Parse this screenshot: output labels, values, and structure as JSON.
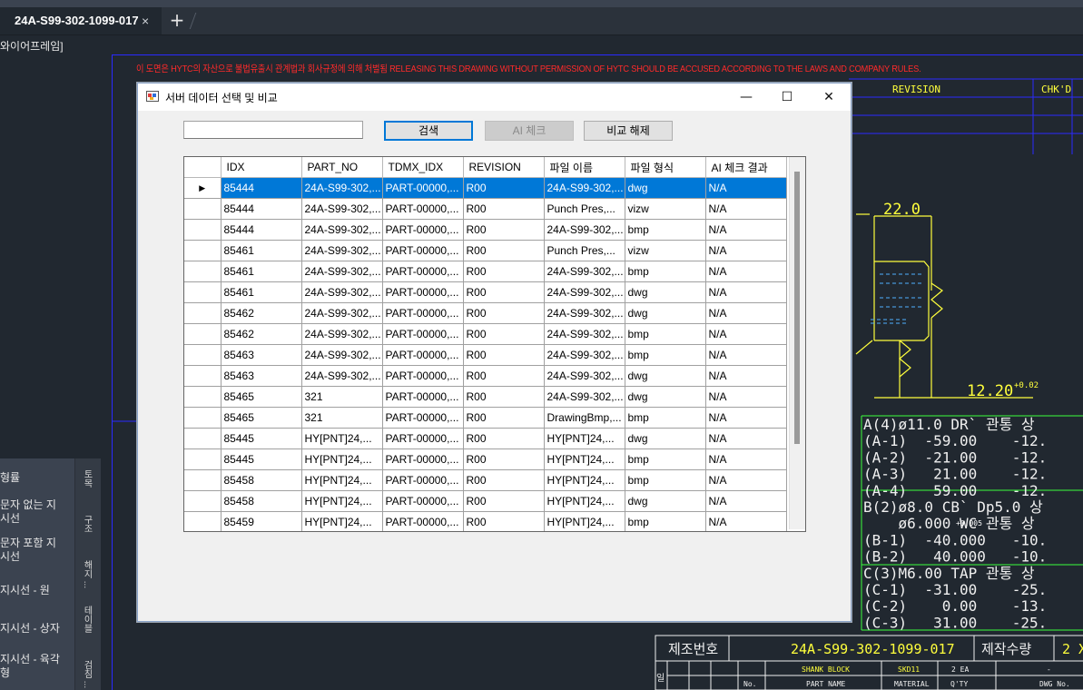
{
  "app": {
    "document_tab": "24A-S99-302-1099-017",
    "tab_close": "×",
    "new_tab": "+",
    "viewport_label": "와이어프레임]"
  },
  "drawing": {
    "warning": "이 도면은 HYTC의 자산으로 불법유출시 관계법과 회사규정에 의해 처벌됨 RELEASING THIS DRAWING WITHOUT PERMISSION OF HYTC SHOULD BE ACCUSED ACCORDING TO THE LAWS AND COMPANY RULES.",
    "revision_header": "REVISION",
    "chkd_header": "CHK'D",
    "dim_top": "22.0",
    "dim_bottom": "12.20",
    "dim_bottom_tol": "+0.02",
    "hole_table": [
      "A(4)ø11.0 DR` 관통 상",
      "(A-1)  -59.00    -12.",
      "(A-2)  -21.00    -12.",
      "(A-3)   21.00    -12.",
      "(A-4)   59.00    -12.",
      "B(2)ø8.0 CB` Dp5.0 상",
      "    ø6.000 WC 관통 상",
      "(B-1)  -40.000   -10.",
      "(B-2)   40.000   -10.",
      "C(3)M6.00 TAP 관통 상",
      "(C-1)  -31.00    -25.",
      "(C-2)    0.00    -13.",
      "(C-3)   31.00    -25."
    ],
    "hole_table_tol": "+0.005",
    "title_block": {
      "mfg_no_label": "제조번호",
      "mfg_no": "24A-S99-302-1099-017",
      "qty_label": "제작수량",
      "qty": "2 X",
      "part_name": "SHANK BLOCK",
      "material": "SKD11",
      "ea": "2 EA",
      "dash": "-",
      "no_label": "No.",
      "part_name_label": "PART NAME",
      "material_label": "MATERIAL",
      "qty_short_label": "Q'TY",
      "dwg_no_label": "DWG No.",
      "row_label": "일"
    }
  },
  "palette": {
    "items": [
      "형률",
      "문자 없는 지\n시선",
      "문자 포함 지\n시선",
      "지시선 - 원",
      "지시선 - 상자",
      "지시선 - 육각\n형"
    ],
    "tabs": [
      "토목",
      "구조",
      "해지 ...",
      "테이블",
      "검침 ..."
    ]
  },
  "dialog": {
    "title": "서버 데이터 선택 및 비교",
    "minimize": "—",
    "maximize": "☐",
    "close": "✕",
    "search_value": "",
    "search_button": "검색",
    "ai_check_button": "AI 체크",
    "compare_clear_button": "비교 해제",
    "grid": {
      "columns": [
        "IDX",
        "PART_NO",
        "TDMX_IDX",
        "REVISION",
        "파일 이름",
        "파일 형식",
        "AI 체크 결과"
      ],
      "rows": [
        [
          "85444",
          "24A-S99-302,...",
          "PART-00000,...",
          "R00",
          "24A-S99-302,...",
          "dwg",
          "N/A"
        ],
        [
          "85444",
          "24A-S99-302,...",
          "PART-00000,...",
          "R00",
          "Punch Pres,...",
          "vizw",
          "N/A"
        ],
        [
          "85444",
          "24A-S99-302,...",
          "PART-00000,...",
          "R00",
          "24A-S99-302,...",
          "bmp",
          "N/A"
        ],
        [
          "85461",
          "24A-S99-302,...",
          "PART-00000,...",
          "R00",
          "Punch Pres,...",
          "vizw",
          "N/A"
        ],
        [
          "85461",
          "24A-S99-302,...",
          "PART-00000,...",
          "R00",
          "24A-S99-302,...",
          "bmp",
          "N/A"
        ],
        [
          "85461",
          "24A-S99-302,...",
          "PART-00000,...",
          "R00",
          "24A-S99-302,...",
          "dwg",
          "N/A"
        ],
        [
          "85462",
          "24A-S99-302,...",
          "PART-00000,...",
          "R00",
          "24A-S99-302,...",
          "dwg",
          "N/A"
        ],
        [
          "85462",
          "24A-S99-302,...",
          "PART-00000,...",
          "R00",
          "24A-S99-302,...",
          "bmp",
          "N/A"
        ],
        [
          "85463",
          "24A-S99-302,...",
          "PART-00000,...",
          "R00",
          "24A-S99-302,...",
          "bmp",
          "N/A"
        ],
        [
          "85463",
          "24A-S99-302,...",
          "PART-00000,...",
          "R00",
          "24A-S99-302,...",
          "dwg",
          "N/A"
        ],
        [
          "85465",
          "321",
          "PART-00000,...",
          "R00",
          "24A-S99-302,...",
          "dwg",
          "N/A"
        ],
        [
          "85465",
          "321",
          "PART-00000,...",
          "R00",
          "DrawingBmp,...",
          "bmp",
          "N/A"
        ],
        [
          "85445",
          "HY[PNT]24,...",
          "PART-00000,...",
          "R00",
          "HY[PNT]24,...",
          "dwg",
          "N/A"
        ],
        [
          "85445",
          "HY[PNT]24,...",
          "PART-00000,...",
          "R00",
          "HY[PNT]24,...",
          "bmp",
          "N/A"
        ],
        [
          "85458",
          "HY[PNT]24,...",
          "PART-00000,...",
          "R00",
          "HY[PNT]24,...",
          "bmp",
          "N/A"
        ],
        [
          "85458",
          "HY[PNT]24,...",
          "PART-00000,...",
          "R00",
          "HY[PNT]24,...",
          "dwg",
          "N/A"
        ],
        [
          "85459",
          "HY[PNT]24,...",
          "PART-00000,...",
          "R00",
          "HY[PNT]24,...",
          "bmp",
          "N/A"
        ]
      ],
      "selected_row": 0,
      "row_indicator": "▶"
    }
  },
  "colors": {
    "cad_yellow": "#ffff3c",
    "cad_blue": "#2a2aff",
    "selection": "#0078d7",
    "warning_red": "#ff2a2a"
  }
}
